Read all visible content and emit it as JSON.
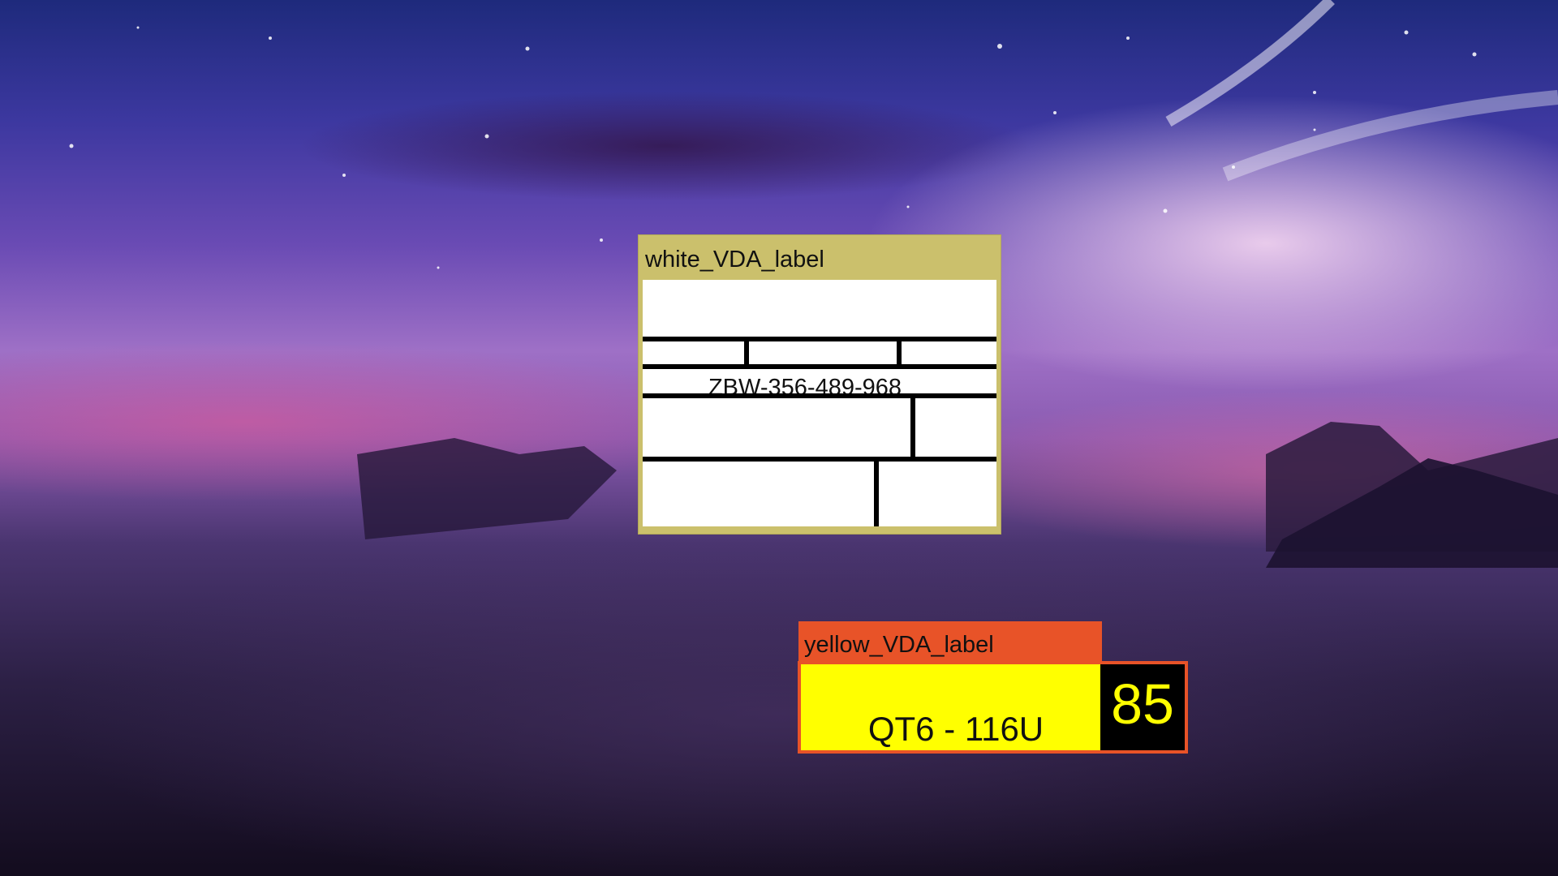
{
  "white_window": {
    "title": "white_VDA_label",
    "label_code": "ZBW-356-489-968",
    "frame_color": "#cbc06c"
  },
  "yellow_window": {
    "title": "yellow_VDA_label",
    "label_code": "QT6 - 116U",
    "count": "85",
    "frame_color": "#e85328",
    "label_color": "#ffff00"
  }
}
